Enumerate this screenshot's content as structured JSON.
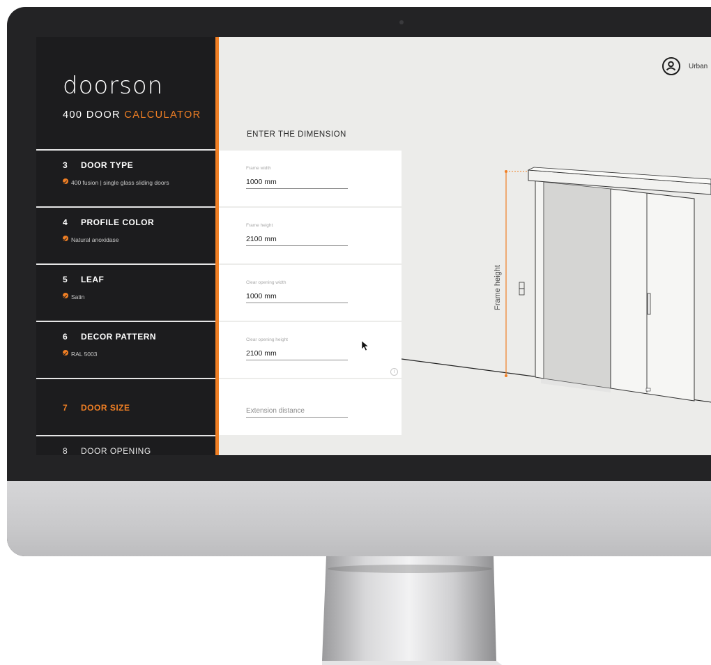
{
  "app": {
    "logo": "doorson",
    "title_part1": "400 DOOR",
    "title_part2": "CALCULATOR"
  },
  "user": {
    "name": "Urban",
    "icon": "user-circle-icon"
  },
  "steps": [
    {
      "num": "3",
      "name": "DOOR TYPE",
      "sub": "400 fusion | single glass sliding doors",
      "done": true
    },
    {
      "num": "4",
      "name": "PROFILE COLOR",
      "sub": "Natural anoxidase",
      "done": true
    },
    {
      "num": "5",
      "name": "LEAF",
      "sub": "Satin",
      "done": true
    },
    {
      "num": "6",
      "name": "DECOR PATTERN",
      "sub": "RAL 5003",
      "done": true
    },
    {
      "num": "7",
      "name": "DOOR SIZE",
      "sub": "",
      "active": true
    },
    {
      "num": "8",
      "name": "DOOR OPENING",
      "sub": ""
    }
  ],
  "form": {
    "title": "ENTER THE DIMENSION",
    "fields": [
      {
        "label": "Frame width",
        "value": "1000 mm"
      },
      {
        "label": "Frame height",
        "value": "2100 mm"
      },
      {
        "label": "Clear opening width",
        "value": "1000 mm"
      },
      {
        "label": "Clear opening height",
        "value": "2100 mm"
      },
      {
        "placeholder": "Extension distance",
        "value": ""
      }
    ],
    "info_icon": "info-icon"
  },
  "drawing": {
    "dimension_label": "Frame height"
  },
  "colors": {
    "accent": "#f07f24",
    "sidebar": "#1c1c1e",
    "screen_bg": "#ececea"
  }
}
